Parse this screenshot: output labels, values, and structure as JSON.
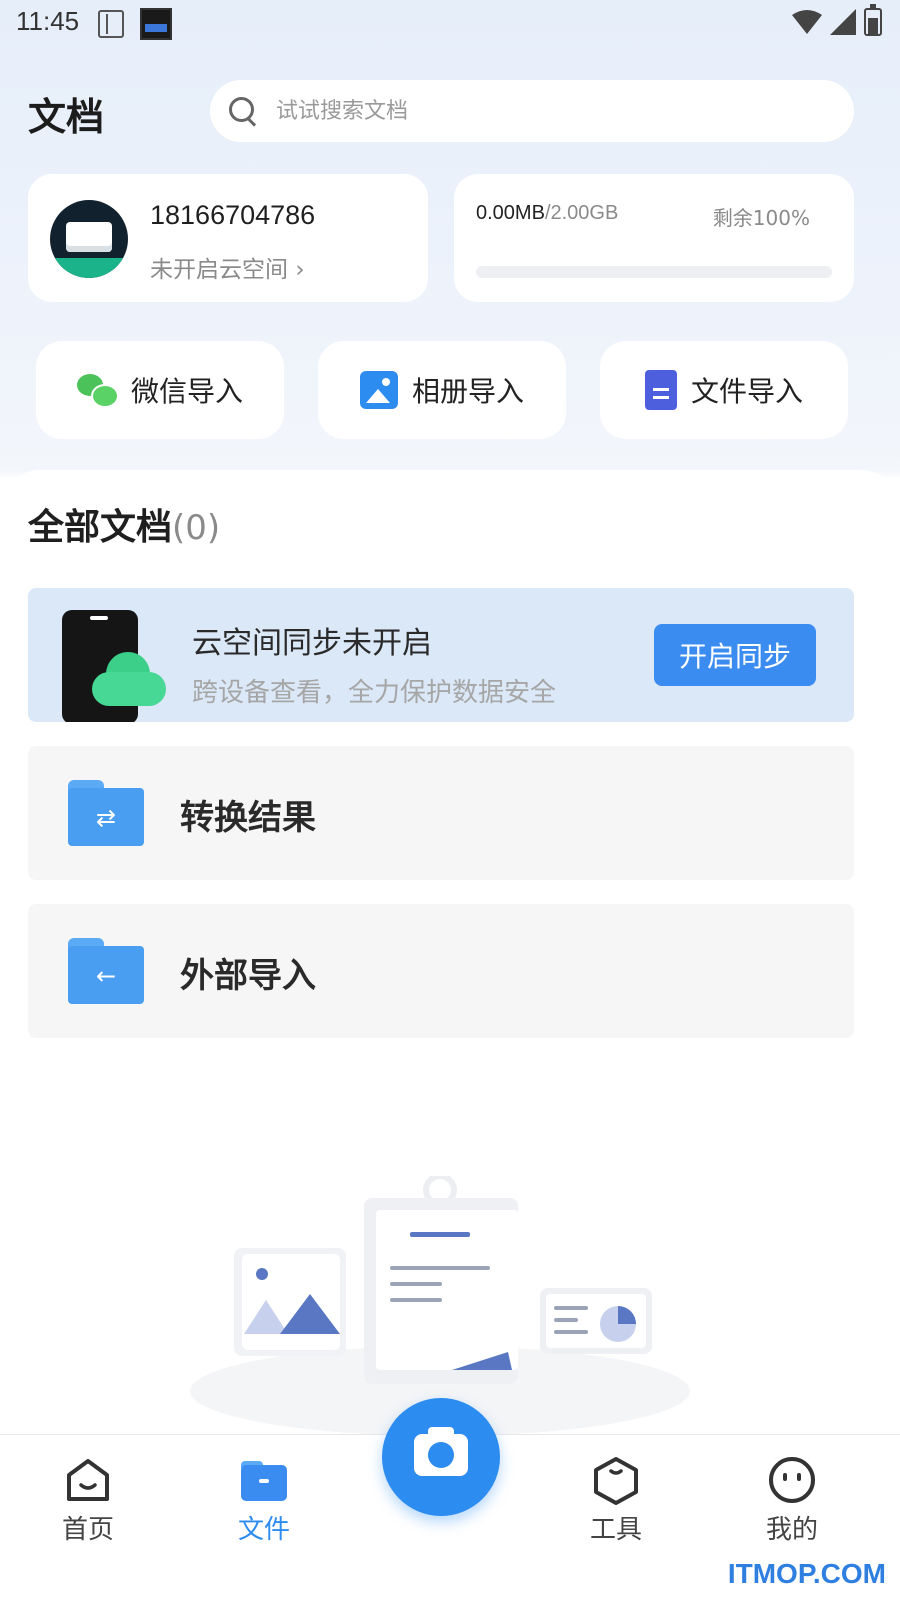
{
  "status_bar": {
    "time": "11:45"
  },
  "header": {
    "title": "文档",
    "search_placeholder": "试试搜索文档"
  },
  "account": {
    "phone": "18166704786",
    "cloud_status": "未开启云空间",
    "chevron": "›"
  },
  "storage": {
    "used": "0.00MB",
    "total": "/2.00GB",
    "remaining": "剩余100%",
    "used_fraction": 0.0
  },
  "imports": [
    {
      "label": "微信导入",
      "icon": "wechat-icon"
    },
    {
      "label": "相册导入",
      "icon": "album-icon"
    },
    {
      "label": "文件导入",
      "icon": "file-icon"
    }
  ],
  "documents": {
    "title": "全部文档",
    "count": "(0)"
  },
  "sync_banner": {
    "title": "云空间同步未开启",
    "subtitle": "跨设备查看，全力保护数据安全",
    "button": "开启同步"
  },
  "folders": [
    {
      "label": "转换结果",
      "icon": "convert-folder-icon",
      "symbol": "⇄"
    },
    {
      "label": "外部导入",
      "icon": "import-folder-icon",
      "symbol": "←"
    }
  ],
  "tabbar": {
    "items": [
      {
        "label": "首页",
        "icon": "home-icon"
      },
      {
        "label": "文件",
        "icon": "folder-icon",
        "active": true
      },
      {
        "label": "工具",
        "icon": "tools-icon"
      },
      {
        "label": "我的",
        "icon": "profile-icon"
      }
    ],
    "camera": "camera-icon"
  },
  "watermark": "ITMOP.COM",
  "colors": {
    "accent": "#2d8cf0",
    "banner_bg": "#dbe8f8",
    "folder_bg": "#f6f6f6"
  }
}
